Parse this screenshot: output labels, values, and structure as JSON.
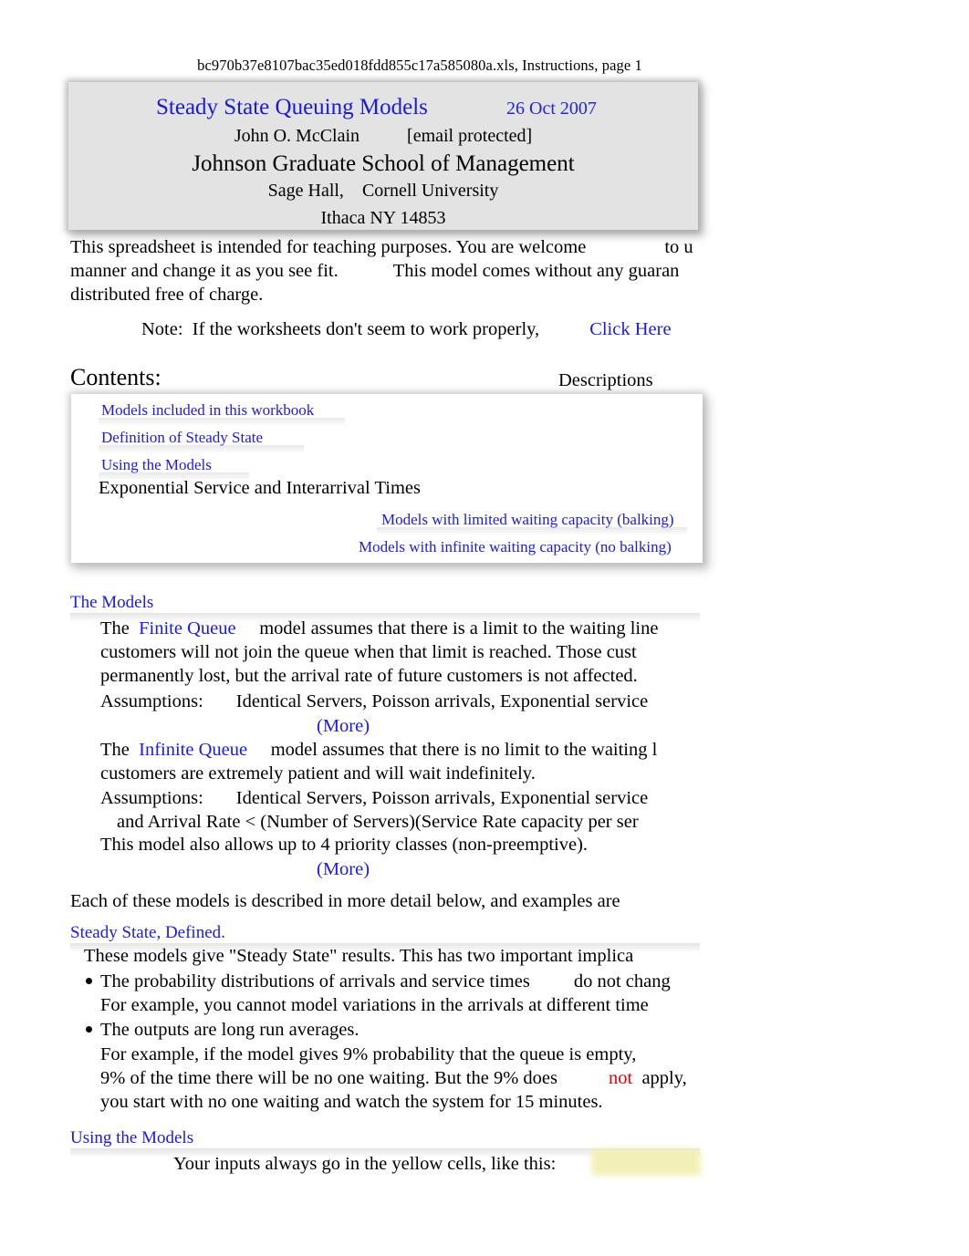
{
  "document": {
    "running_head": "bc970b37e8107bac35ed018fdd855c17a585080a.xls, Instructions, page 1"
  },
  "title_card": {
    "title": "Steady State Queuing Models",
    "date": "26 Oct 2007",
    "author": "John O. McClain",
    "email": "[email protected]",
    "school": "Johnson Graduate School of Management",
    "building": "Sage Hall,",
    "university": "Cornell University",
    "city_state_zip": "Ithaca NY 14853"
  },
  "intro": {
    "line1_a": "This spreadsheet is intended for teaching purposes. You are welcome",
    "line1_b": "to u",
    "line2_a": "manner and change it as you see fit.",
    "line2_b": "This model comes without any guaran",
    "line3": "distributed free of charge.",
    "note_label": "Note:",
    "note_text": "If the worksheets don't seem to work properly,",
    "note_link": "Click Here"
  },
  "contents": {
    "heading": "Contents:",
    "descriptions_label": "Descriptions",
    "items": [
      {
        "label": "Models included in this workbook"
      },
      {
        "label": "Definition of Steady State"
      },
      {
        "label": "Using the Models"
      },
      {
        "label": "Exponential Service and Interarrival Times"
      },
      {
        "label": "Models with limited waiting capacity (balking)"
      },
      {
        "label": "Models with infinite waiting capacity (no balking)"
      }
    ]
  },
  "models_section": {
    "heading": "The Models",
    "finite": {
      "lead": "The",
      "link": "Finite Queue",
      "line1_rest": "model assumes that there is a limit to the waiting line",
      "line2": "customers will not join the queue when that limit is reached. Those cust",
      "line3": "permanently lost, but the arrival rate of future customers is not affected.",
      "assumptions_label": "Assumptions:",
      "assumptions_text": "Identical Servers, Poisson arrivals, Exponential service",
      "more": "(More)"
    },
    "infinite": {
      "lead": "The",
      "link": "Infinite Queue",
      "line1_rest": "model assumes that there is no limit to the waiting l",
      "line2": "customers are extremely patient and will wait indefinitely.",
      "assumptions_label": "Assumptions:",
      "assumptions_text": "Identical Servers, Poisson arrivals, Exponential service",
      "line4": "and Arrival Rate < (Number of Servers)(Service Rate capacity per ser",
      "line5": "This model also allows up to 4 priority classes (non-preemptive).",
      "more": "(More)"
    },
    "closing": "Each of these models is described in more detail below, and examples are"
  },
  "steady_state_section": {
    "heading": "Steady State, Defined.",
    "intro": "These models give \"Steady State\" results. This has two important implica",
    "bullet1_a": "The probability distributions of arrivals and service times",
    "bullet1_b": "do not chang",
    "bullet1_sub": "For example, you cannot model variations in the arrivals at different time",
    "bullet2": "The outputs are long run averages.",
    "bullet2_sub1": "For example, if the model gives 9% probability that the queue is empty,",
    "bullet2_sub2_a": "9% of the time there will be no one waiting. But the 9% does",
    "bullet2_sub2_red": "not",
    "bullet2_sub2_b": "apply,",
    "bullet2_sub3": "you start with no one waiting and watch the system for 15 minutes."
  },
  "using_section": {
    "heading": "Using the Models",
    "instruction": "Your inputs always go in the yellow cells, like this:",
    "yellow_cell_value": ""
  },
  "colors": {
    "link_blue": "#1a1aef",
    "title_blue": "#1919e0",
    "alert_red": "#e60000",
    "card_gray": "#e3e3e3",
    "input_yellow": "#f2f0b4"
  }
}
